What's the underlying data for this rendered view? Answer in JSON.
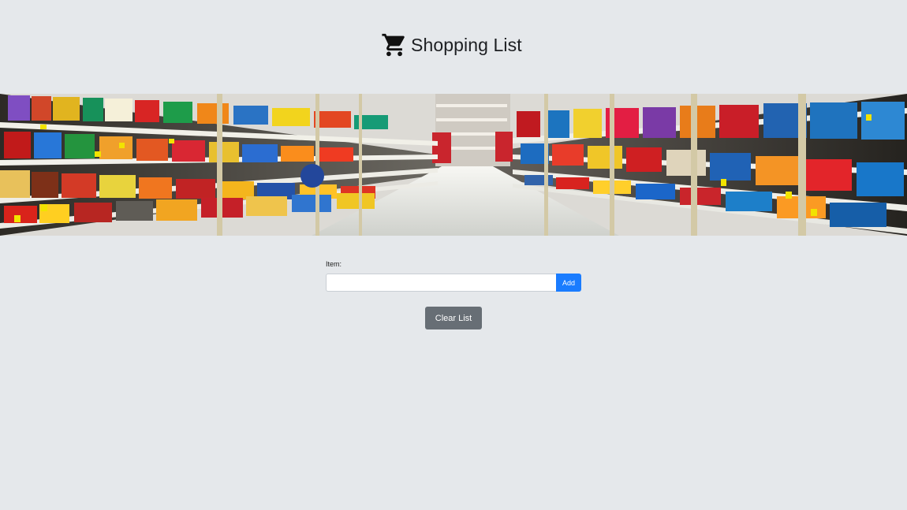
{
  "header": {
    "icon": "shopping-cart-icon",
    "title": "Shopping List"
  },
  "banner": {
    "image": "grocery-store-aisle-photo"
  },
  "form": {
    "item_label": "Item:",
    "item_value": "",
    "item_placeholder": "",
    "add_label": "Add"
  },
  "actions": {
    "clear_label": "Clear List"
  },
  "colors": {
    "background": "#e5e8eb",
    "primary": "#1a7cff",
    "secondary": "#676e75"
  },
  "list": {
    "items": []
  }
}
